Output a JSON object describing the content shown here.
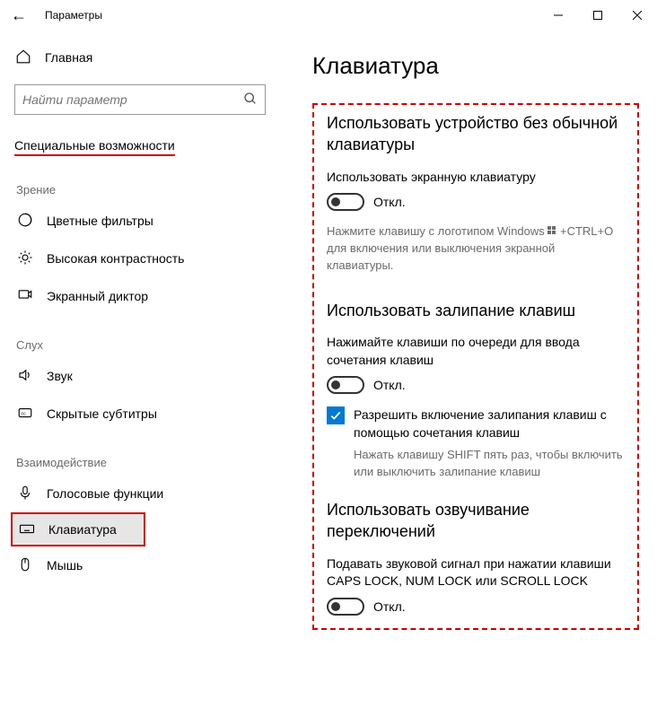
{
  "window": {
    "title": "Параметры"
  },
  "sidebar": {
    "home_label": "Главная",
    "search_placeholder": "Найти параметр",
    "section_label": "Специальные возможности",
    "groups": [
      {
        "label": "Зрение",
        "items": [
          {
            "icon": "color-filters",
            "label": "Цветные фильтры"
          },
          {
            "icon": "brightness",
            "label": "Высокая контрастность"
          },
          {
            "icon": "narrator",
            "label": "Экранный диктор"
          }
        ]
      },
      {
        "label": "Слух",
        "items": [
          {
            "icon": "volume",
            "label": "Звук"
          },
          {
            "icon": "cc",
            "label": "Скрытые субтитры"
          }
        ]
      },
      {
        "label": "Взаимодействие",
        "items": [
          {
            "icon": "speech",
            "label": "Голосовые функции"
          },
          {
            "icon": "keyboard",
            "label": "Клавиатура",
            "highlight": true
          },
          {
            "icon": "mouse",
            "label": "Мышь"
          }
        ]
      }
    ]
  },
  "content": {
    "page_title": "Клавиатура",
    "sections": [
      {
        "heading": "Использовать устройство без обычной клавиатуры",
        "label": "Использовать экранную клавиатуру",
        "toggle_state": "Откл.",
        "hint_pre": "Нажмите клавишу с логотипом Windows ",
        "hint_post": " +CTRL+O для включения или выключения экранной клавиатуры."
      },
      {
        "heading": "Использовать залипание клавиш",
        "label": "Нажимайте клавиши по очереди для ввода сочетания клавиш",
        "toggle_state": "Откл.",
        "checkbox_label": "Разрешить включение залипания клавиш с помощью сочетания клавиш",
        "checkbox_hint": "Нажать клавишу SHIFT пять раз, чтобы включить или выключить залипание клавиш"
      },
      {
        "heading": "Использовать озвучивание переключений",
        "label": "Подавать звуковой сигнал при нажатии клавиши CAPS LOCK, NUM LOCK или SCROLL LOCK",
        "toggle_state": "Откл."
      }
    ]
  }
}
